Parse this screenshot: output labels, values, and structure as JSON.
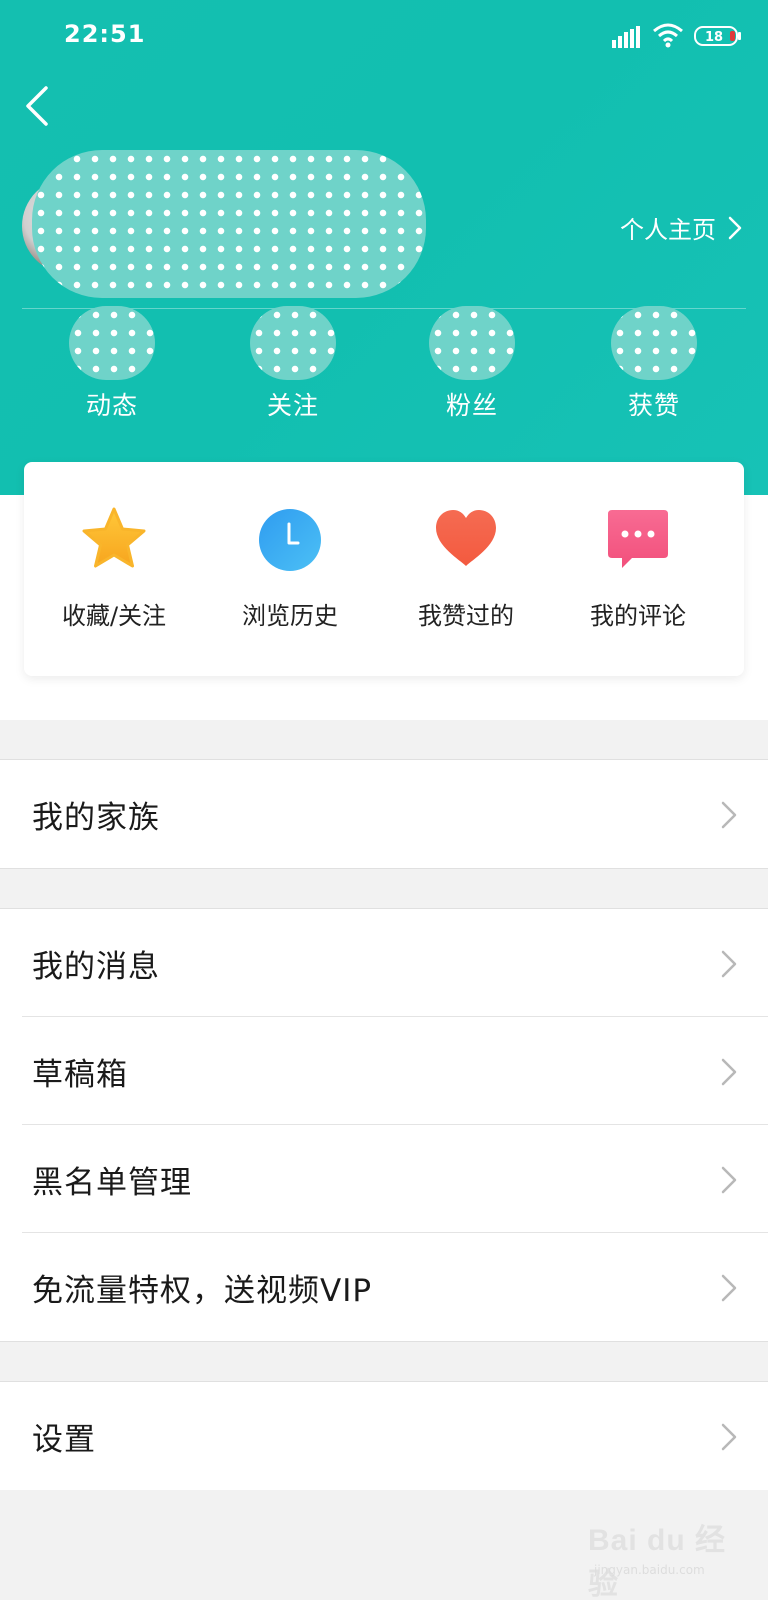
{
  "status_bar": {
    "time": "22:51",
    "battery": "18"
  },
  "profile": {
    "homepage_label": "个人主页"
  },
  "stats": [
    {
      "label": "动态"
    },
    {
      "label": "关注"
    },
    {
      "label": "粉丝"
    },
    {
      "label": "获赞"
    }
  ],
  "quick_actions": [
    {
      "label": "收藏/关注",
      "icon": "star-icon",
      "color": "#f9b52b"
    },
    {
      "label": "浏览历史",
      "icon": "clock-icon",
      "color": "#3aa6f2"
    },
    {
      "label": "我赞过的",
      "icon": "heart-icon",
      "color": "#f4644a"
    },
    {
      "label": "我的评论",
      "icon": "comment-icon",
      "color": "#f65a88"
    }
  ],
  "menu": {
    "family": "我的家族",
    "messages": "我的消息",
    "drafts": "草稿箱",
    "blacklist": "黑名单管理",
    "free_data": "免流量特权，送视频VIP",
    "settings": "设置"
  },
  "watermark": {
    "brand": "Bai du 经验",
    "url": "jingyan.baidu.com"
  },
  "colors": {
    "header": "#14bfb0"
  }
}
